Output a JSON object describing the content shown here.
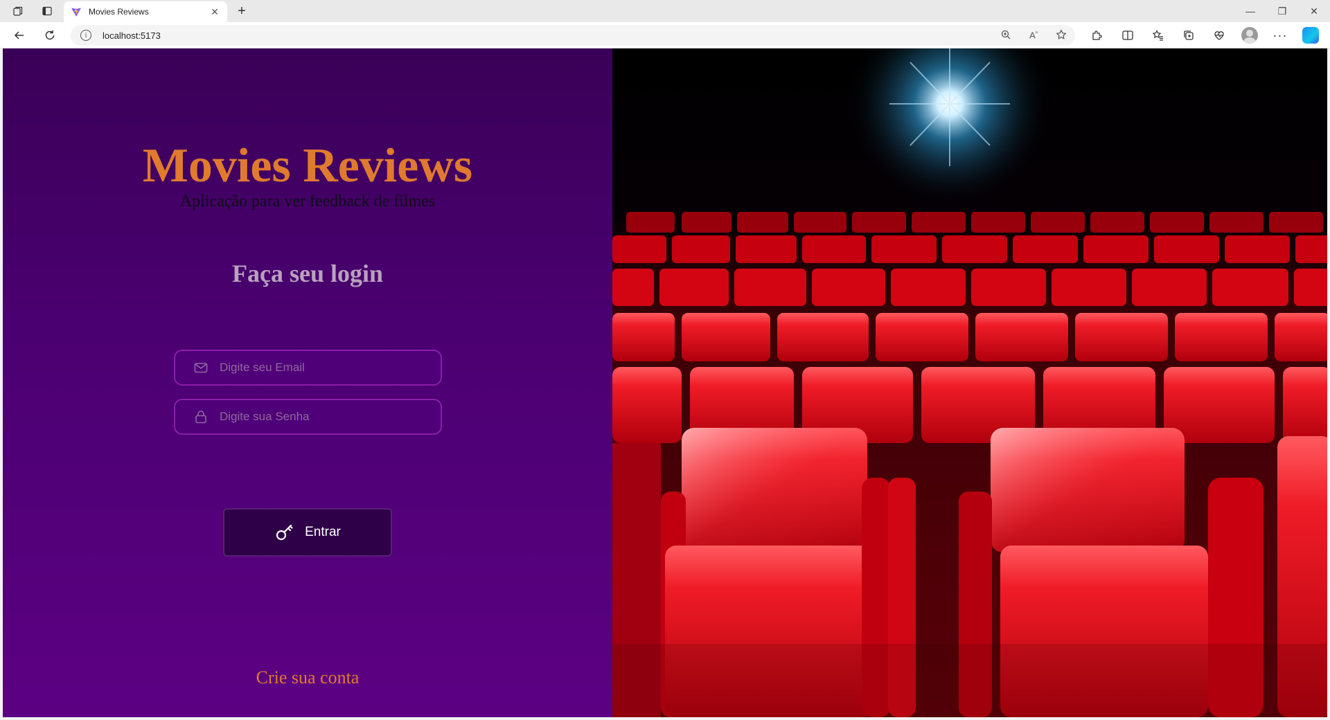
{
  "browser": {
    "tab_title": "Movies Reviews",
    "url": "localhost:5173"
  },
  "icons": {
    "tab_actions": "tab-actions-icon",
    "vertical_tabs": "vertical-tabs-icon",
    "favicon": "vite-logo-icon",
    "close_tab": "close-icon",
    "new_tab": "plus-icon",
    "back": "back-arrow-icon",
    "refresh": "refresh-icon",
    "site_info": "info-icon",
    "zoom": "zoom-icon",
    "read_aloud": "read-aloud-icon",
    "favorite": "star-icon",
    "extensions": "puzzle-icon",
    "split": "split-screen-icon",
    "favorites": "favorites-icon",
    "collections": "collections-icon",
    "performance": "heart-pulse-icon",
    "profile": "avatar",
    "more": "ellipsis-icon",
    "copilot": "copilot-icon",
    "email_field": "mail-icon",
    "password_field": "lock-icon",
    "login_button": "key-icon"
  },
  "colors": {
    "brand_orange": "#e07a2f",
    "panel_purple": "#4a0070",
    "seat_red": "#e0121d"
  },
  "app": {
    "title": "Movies Reviews",
    "subtitle": "Aplicação para ver feedback de filmes",
    "login_heading": "Faça seu login",
    "email_placeholder": "Digite seu Email",
    "password_placeholder": "Digite sua Senha",
    "login_button": "Entrar",
    "create_account": "Crie sua conta"
  }
}
